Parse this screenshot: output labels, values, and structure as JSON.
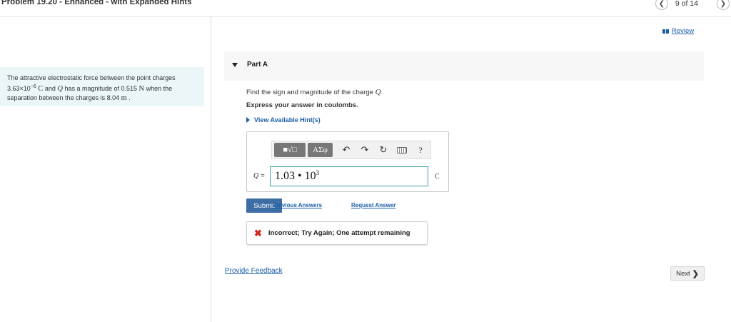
{
  "header": {
    "problem_title": "Problem 19.20 - Enhanced - with Expanded Hints",
    "pager": {
      "prev_icon": "chevron-left-icon",
      "text": "9 of 14",
      "next_icon": "chevron-right-icon"
    }
  },
  "problem": {
    "text_1": "The attractive electrostatic force between the point charges",
    "charge_value": "3.63×10",
    "charge_exp": "−6",
    "unit_C": "C",
    "text_2": " and ",
    "var_Q": "Q",
    "text_3": " has a magnitude of 0.515 ",
    "unit_N": "N",
    "text_4": " when the separation between the charges is 8.04 ",
    "unit_m": "m",
    "text_5": " ."
  },
  "review": {
    "icon": "review-bars-icon",
    "label": "Review"
  },
  "part": {
    "caret_icon": "caret-down-icon",
    "title": "Part A"
  },
  "question": {
    "prompt_text": "Find the sign and magnitude of the charge ",
    "prompt_var": "Q",
    "prompt_end": ".",
    "express": "Express your answer in coulombs.",
    "hints_label": "View Available Hint(s)"
  },
  "answer": {
    "toolbar": {
      "template_label": "■√□",
      "greek_label": "ΑΣφ",
      "undo_glyph": "↶",
      "redo_glyph": "↷",
      "reset_glyph": "↻",
      "keyboard_icon": "keyboard-icon",
      "help_label": "?"
    },
    "var_label": "Q",
    "equals": " = ",
    "value_mantissa": "1.03 • 10",
    "value_exponent": "3",
    "unit": "C"
  },
  "actions": {
    "submit_label": "Submit",
    "previous_answers_label": "Previous Answers",
    "request_answer_label": "Request Answer"
  },
  "feedback": {
    "icon": "x-icon",
    "text": "Incorrect; Try Again; One attempt remaining"
  },
  "footer": {
    "provide_feedback_label": "Provide Feedback",
    "next_label": "Next",
    "next_chevron": "❯"
  },
  "colors": {
    "link": "#1a5fa8",
    "submit": "#3d6fa5",
    "error": "#d0271d",
    "problem_bg": "#eaf6f7"
  }
}
